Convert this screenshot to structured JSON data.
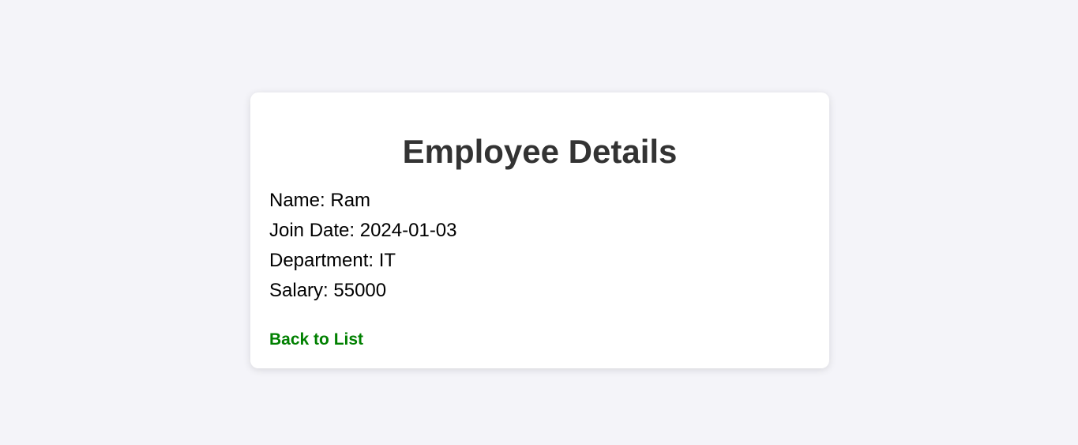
{
  "page": {
    "title": "Employee Details"
  },
  "employee": {
    "name_label": "Name:",
    "name": "Ram",
    "join_date_label": "Join Date:",
    "join_date": "2024-01-03",
    "department_label": "Department:",
    "department": "IT",
    "salary_label": "Salary:",
    "salary": "55000"
  },
  "actions": {
    "back_label": "Back to List"
  },
  "colors": {
    "background": "#f4f4f9",
    "card": "#ffffff",
    "title": "#333333",
    "link": "#008000"
  }
}
